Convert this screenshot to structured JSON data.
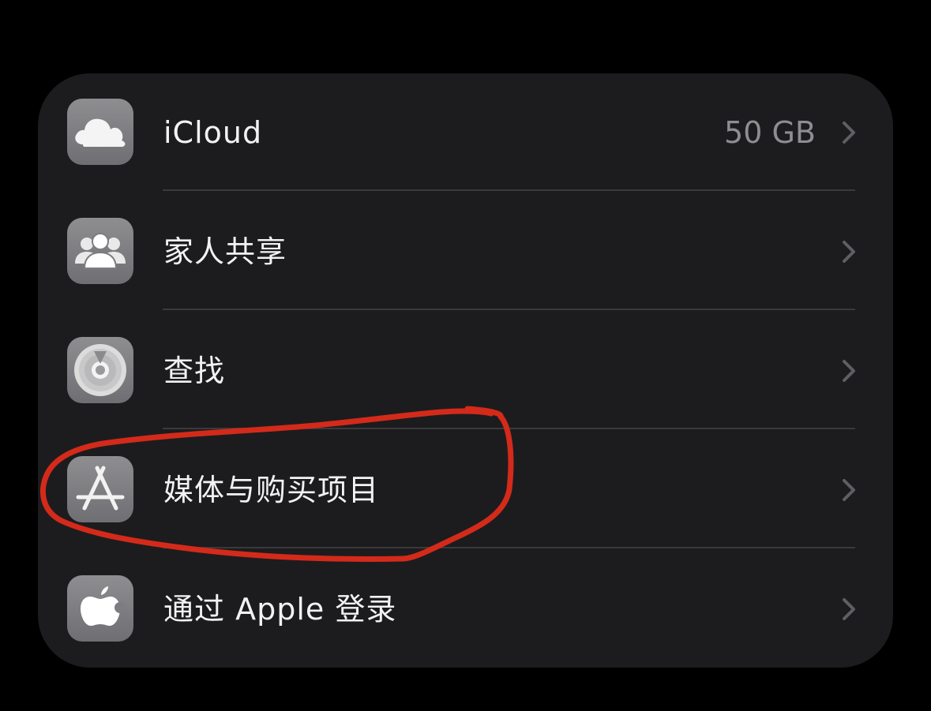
{
  "settings_list": {
    "items": [
      {
        "label": "iCloud",
        "detail": "50 GB",
        "icon": "icloud-icon"
      },
      {
        "label": "家人共享",
        "detail": "",
        "icon": "family-sharing-icon"
      },
      {
        "label": "查找",
        "detail": "",
        "icon": "find-my-icon"
      },
      {
        "label": "媒体与购买项目",
        "detail": "",
        "icon": "app-store-icon"
      },
      {
        "label": "通过 Apple 登录",
        "detail": "",
        "icon": "apple-logo-icon"
      }
    ]
  },
  "annotation": {
    "shape": "freehand-circle",
    "color": "#d42a1a",
    "target": "媒体与购买项目"
  },
  "colors": {
    "background": "#000000",
    "panel": "#1c1c1e",
    "separator": "#3a3a3c",
    "label": "#f2f2f2",
    "detail": "#8d8d92",
    "chevron": "#5e5e63",
    "icon_tile": "#7d7d81"
  }
}
